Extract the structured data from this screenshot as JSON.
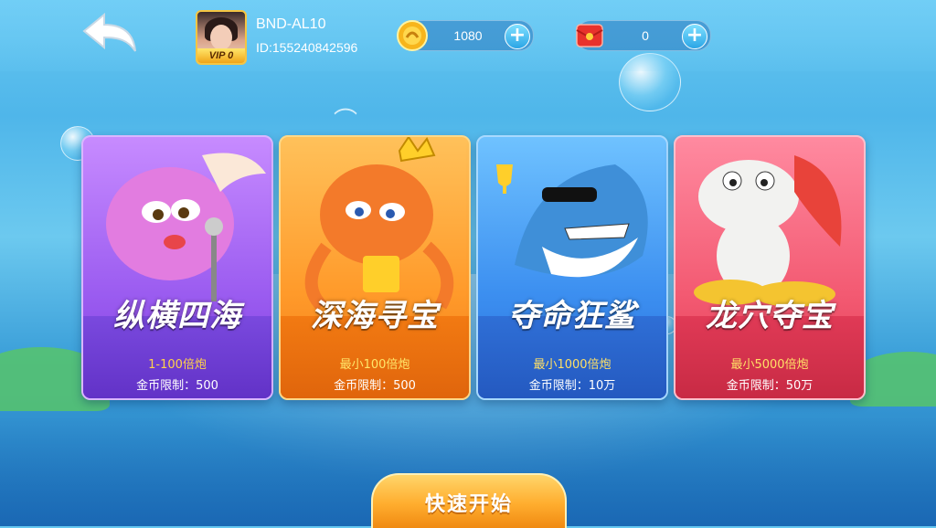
{
  "header": {
    "username": "BND-AL10",
    "user_id": "ID:155240842596",
    "vip_label": "VIP 0",
    "coins": "1080",
    "coins_icon": "gold-coin-icon",
    "red_packets": "0",
    "red_packets_icon": "red-envelope-icon",
    "back_icon": "back-arrow-icon"
  },
  "rooms": [
    {
      "title": "纵横四海",
      "range": "1-100倍炮",
      "limit": "金币限制：500",
      "mascot": "pink-fish-icon",
      "color": "#9b5cf0"
    },
    {
      "title": "深海寻宝",
      "range": "最小100倍炮",
      "limit": "金币限制：500",
      "mascot": "octopus-king-icon",
      "color": "#ff9a2a"
    },
    {
      "title": "夺命狂鲨",
      "range": "最小1000倍炮",
      "limit": "金币限制：10万",
      "mascot": "shark-icon",
      "color": "#3c8ff0"
    },
    {
      "title": "龙穴夺宝",
      "range": "最小5000倍炮",
      "limit": "金币限制：50万",
      "mascot": "dragon-icon",
      "color": "#f35a72"
    }
  ],
  "quick_start": {
    "label": "快速开始"
  }
}
